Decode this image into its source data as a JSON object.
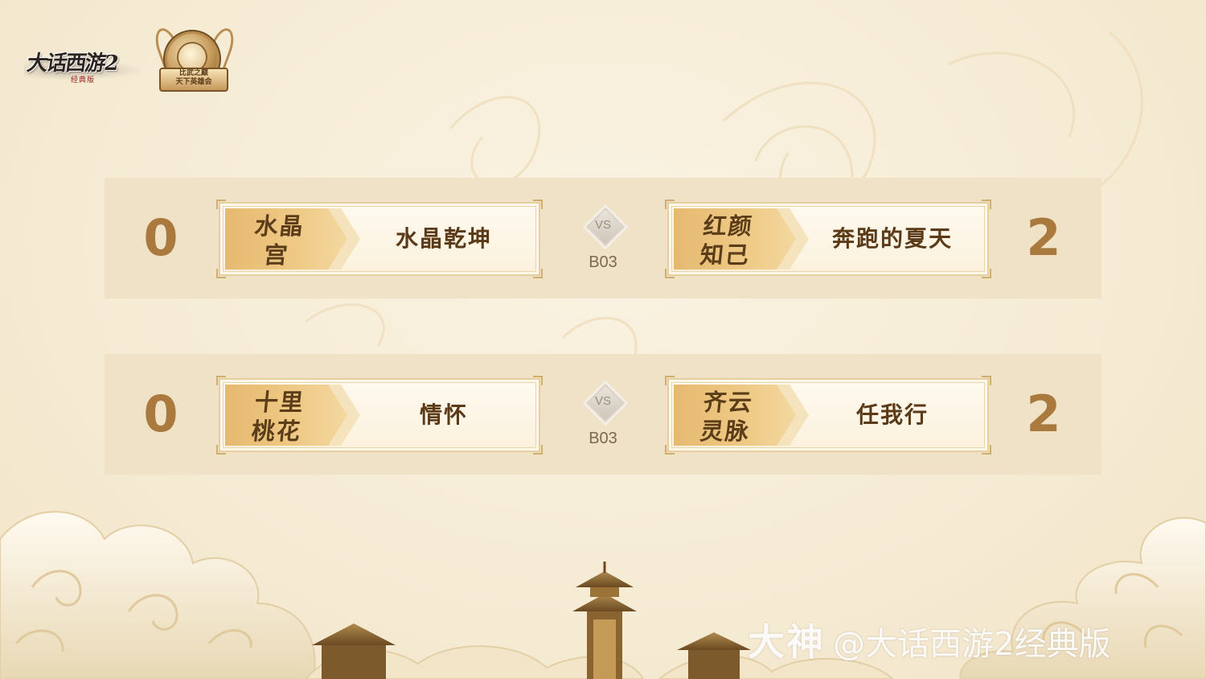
{
  "logos": {
    "game_title": "大话西游2",
    "game_edition": "经典版",
    "event_title": "比武之巅",
    "event_subtitle": "天下英雄会"
  },
  "matches": [
    {
      "left_score": "0",
      "left_faction": "水晶宫",
      "left_team": "水晶乾坤",
      "vs": "VS",
      "format": "B03",
      "right_faction": "红颜知己",
      "right_team": "奔跑的夏天",
      "right_score": "2"
    },
    {
      "left_score": "0",
      "left_faction": "十里桃花",
      "left_team": "情怀",
      "vs": "VS",
      "format": "B03",
      "right_faction": "齐云灵脉",
      "right_team": "任我行",
      "right_score": "2"
    }
  ],
  "watermark": {
    "brand": "大神",
    "handle": "@大话西游2经典版"
  },
  "colors": {
    "background": "#f6ecd5",
    "row_band": "#efe2c6",
    "score": "#a9793d",
    "faction_tag": "#efca86",
    "text_dark": "#5a3a17"
  }
}
